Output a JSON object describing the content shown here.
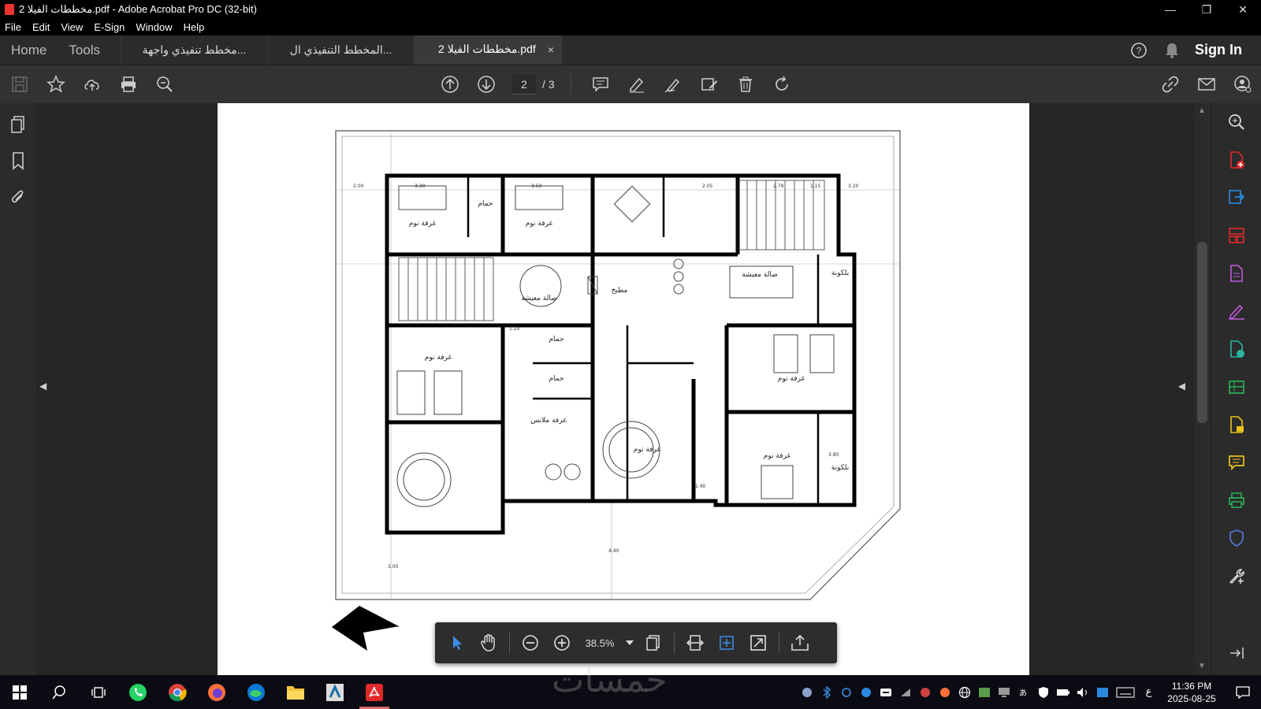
{
  "window": {
    "title": "مخططات الفيلا 2.pdf - Adobe Acrobat Pro DC (32-bit)",
    "minimize": "—",
    "restore": "❐",
    "close": "✕"
  },
  "menu": [
    "File",
    "Edit",
    "View",
    "E-Sign",
    "Window",
    "Help"
  ],
  "tabs": {
    "home": "Home",
    "tools": "Tools",
    "documents": [
      {
        "label": "مخطط تنفيذي واجهة...",
        "active": false
      },
      {
        "label": "المخطط التنفيذي ال...",
        "active": false
      },
      {
        "label": "مخططات الفيلا 2.pdf",
        "active": true,
        "close": "×"
      }
    ],
    "help_icon": "help-circle-icon",
    "bell_icon": "bell-icon",
    "sign_in": "Sign In"
  },
  "toolbar": {
    "left_icons": [
      "save-icon",
      "star-icon",
      "upload-cloud-icon",
      "print-icon",
      "zoom-search-icon"
    ],
    "page_current": "2",
    "page_total": "/ 3",
    "annotate_icons": [
      "comment-icon",
      "highlight-pen-icon",
      "sign-pen-icon",
      "edit-stamp-icon",
      "trash-icon",
      "rotate-icon"
    ],
    "right_icons": [
      "share-link-icon",
      "email-icon",
      "account-icon"
    ]
  },
  "leftbar": [
    "page-thumbnails-icon",
    "bookmark-icon",
    "attachment-icon"
  ],
  "rightbar": [
    "search-zoom-icon",
    "create-pdf-icon",
    "export-pdf-icon",
    "organize-pages-icon",
    "edit-pdf-icon",
    "fill-sign-icon",
    "request-signature-icon",
    "scan-ocr-icon",
    "protect-file-icon",
    "comment-tool-icon",
    "print-production-icon",
    "shield-icon",
    "more-tools-icon",
    "collapse-pane-icon"
  ],
  "floating_toolbar": {
    "zoom": "38.5%",
    "icons": [
      "select-arrow-icon",
      "hand-pan-icon",
      "zoom-out-icon",
      "zoom-in-icon",
      "zoom-dropdown-icon",
      "page-display-icon",
      "fit-width-icon",
      "fit-page-icon",
      "full-screen-icon",
      "share-upload-icon"
    ]
  },
  "drawing": {
    "rooms": [
      {
        "label": "غرفة نوم"
      },
      {
        "label": "غرفة نوم"
      },
      {
        "label": "صالة معيشة"
      },
      {
        "label": "مطبخ"
      },
      {
        "label": "صالة معيشة"
      },
      {
        "label": "غرفة نوم"
      },
      {
        "label": "غرفة نوم"
      },
      {
        "label": "غرفة ملابس"
      },
      {
        "label": "غرفة نوم"
      },
      {
        "label": "غرفة نوم"
      },
      {
        "label": "حمام"
      },
      {
        "label": "حمام"
      },
      {
        "label": "حمام"
      },
      {
        "label": "بلكونة"
      },
      {
        "label": "بلكونة"
      }
    ],
    "dims": [
      "3.30",
      "3.50",
      "2.05",
      "2.79",
      "1.15",
      "3.20",
      "2.00",
      "4.40",
      "3.00",
      "1.20",
      "1.40",
      "3.80"
    ]
  },
  "taskbar": {
    "apps": [
      "windows-start-icon",
      "search-icon",
      "task-view-icon",
      "whatsapp-icon",
      "chrome-icon",
      "firefox-icon",
      "edge-icon",
      "file-explorer-icon",
      "autocad-icon",
      "acrobat-icon"
    ],
    "active_app": "acrobat-icon",
    "tray": [
      "app-tray-icon",
      "bluetooth-icon",
      "circle-tray-icon",
      "blue-tray-icon",
      "media-tray-icon",
      "wifi-icon",
      "network-icon",
      "firefox-tray-icon",
      "globe-icon",
      "green-tray-icon",
      "display-icon",
      "ime-icon",
      "defender-icon",
      "battery-icon",
      "volume-icon",
      "monitor-icon",
      "keyboard-icon"
    ],
    "lang": "ع",
    "time": "11:36 PM",
    "date": "2025-08-25",
    "notification_icon": "notification-icon"
  },
  "watermark": "خمسات",
  "colors": {
    "acrobat_red": "#e0292b",
    "rightbar_purple": "#c05ae0",
    "rightbar_yellow": "#e8c21a",
    "rightbar_green": "#27b55a",
    "rightbar_blue": "#2b8ae0"
  }
}
